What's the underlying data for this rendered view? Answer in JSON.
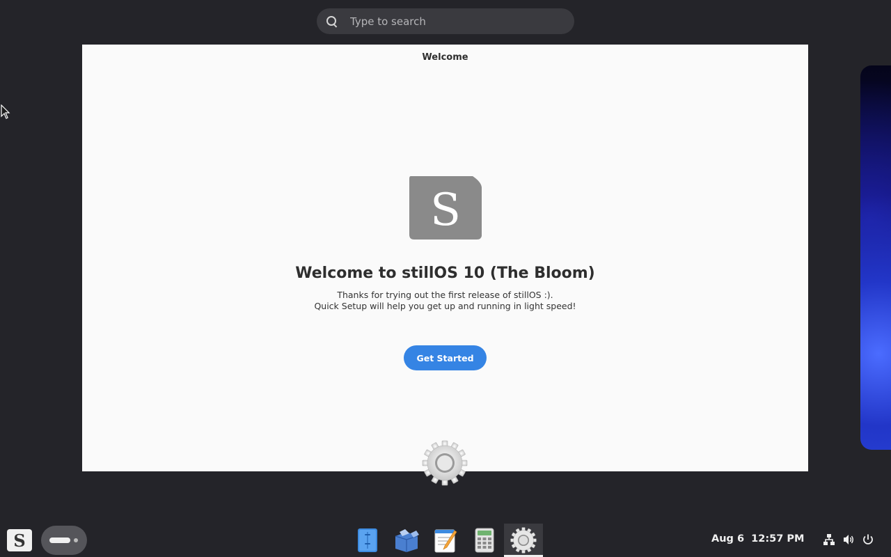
{
  "search": {
    "placeholder": "Type to search"
  },
  "window": {
    "title": "Welcome",
    "heading": "Welcome to stillOS 10 (The Bloom)",
    "description_line1": "Thanks for trying out the first release of stillOS :).",
    "description_line2": "Quick Setup will help you get up and running in light speed!",
    "button_label": "Get Started",
    "logo_letter": "S"
  },
  "panel": {
    "start_letter": "S",
    "dock": [
      {
        "name": "file-manager-icon"
      },
      {
        "name": "software-center-icon"
      },
      {
        "name": "text-editor-icon"
      },
      {
        "name": "calculator-icon"
      },
      {
        "name": "settings-icon",
        "active": true
      }
    ],
    "clock_date": "Aug 6",
    "clock_time": "12:57 PM"
  },
  "colors": {
    "desktop_bg": "#242429",
    "accent": "#3584e4",
    "window_bg": "#fafafa"
  }
}
